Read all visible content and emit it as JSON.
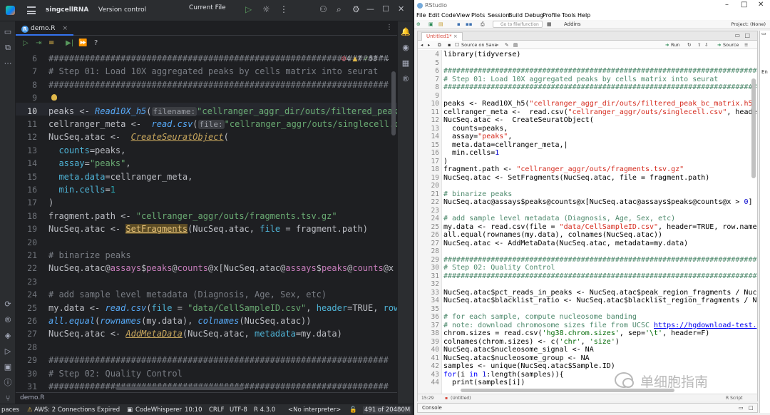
{
  "left_ide": {
    "project": "singcellRNA",
    "vcs": "Version control",
    "run_target": "Current File",
    "tab": {
      "label": "demo.R",
      "close": "×"
    },
    "inspections": {
      "errors": "4",
      "warnings": "7",
      "typos": "53"
    },
    "breadcrumb": "demo.R",
    "lines": [
      {
        "n": "6",
        "html": "<span class=\"cmt\">##################################################################</span>"
      },
      {
        "n": "7",
        "html": "<span class=\"cmt\"># Step 01: Load 10X aggregated peaks by cells matrix into seurat</span>"
      },
      {
        "n": "8",
        "html": "<span class=\"cmt\">##################################################################</span>"
      },
      {
        "n": "9",
        "html": ""
      },
      {
        "n": "10",
        "html": "peaks &lt;- <span class=\"fn\">Read10X_h5</span>(<span class=\"hint\">filename:</span><span class=\"str\">\"cellranger_aggr_dir/outs/filtered_peak_bc</span>"
      },
      {
        "n": "11",
        "html": "cellranger_meta &lt;-  <span class=\"fn\">read.csv</span>(<span class=\"hint\">file:</span><span class=\"str\">\"cellranger_aggr/outs/singlecell.csv\"</span>,"
      },
      {
        "n": "12",
        "html": "NucSeq.atac &lt;-  <span class=\"fn2\">CreateSeuratObject</span>("
      },
      {
        "n": "13",
        "html": "  <span class=\"arg\">counts</span>=peaks,"
      },
      {
        "n": "14",
        "html": "  <span class=\"arg\">assay</span>=<span class=\"str\">\"peaks\"</span>,"
      },
      {
        "n": "15",
        "html": "  <span class=\"arg\">meta.data</span>=cellranger_meta,"
      },
      {
        "n": "16",
        "html": "  <span class=\"arg\">min.cells</span>=<span class=\"num\">1</span>"
      },
      {
        "n": "17",
        "html": ")"
      },
      {
        "n": "18",
        "html": "fragment.path &lt;- <span class=\"str\">\"cellranger_aggr/outs/fragments.tsv.gz\"</span>"
      },
      {
        "n": "19",
        "html": "NucSeq.atac &lt;- <span class=\"hl-yel\">SetFragments</span>(NucSeq.atac, <span class=\"arg\">file</span> = fragment.path)"
      },
      {
        "n": "20",
        "html": ""
      },
      {
        "n": "21",
        "html": "<span class=\"cmt\"># binarize peaks</span>"
      },
      {
        "n": "22",
        "html": "NucSeq.atac@<span class=\"attr\">assays</span>$<span class=\"attr\">peaks</span>@<span class=\"attr\">counts</span>@x[NucSeq.atac@<span class=\"attr\">assays</span>$<span class=\"attr\">peaks</span>@<span class=\"attr\">counts</span>@x &gt; <span class=\"num\">0</span>]"
      },
      {
        "n": "23",
        "html": ""
      },
      {
        "n": "24",
        "html": "<span class=\"cmt\"># add sample level metadata (Diagnosis, Age, Sex, etc)</span>"
      },
      {
        "n": "25",
        "html": "my.data &lt;- <span class=\"fn\">read.csv</span>(<span class=\"arg\">file</span> = <span class=\"str\">\"data/CellSampleID.csv\"</span>, <span class=\"arg\">header</span>=TRUE, <span class=\"arg\">row.names</span>"
      },
      {
        "n": "26",
        "html": "<span class=\"fn\">all.equal</span>(<span class=\"fn\">rownames</span>(my.data), <span class=\"fn\">colnames</span>(NucSeq.atac))"
      },
      {
        "n": "27",
        "html": "NucSeq.atac &lt;- <span class=\"fn2\">AddMetaData</span>(NucSeq.atac, <span class=\"arg\">metadata</span>=my.data)"
      },
      {
        "n": "28",
        "html": ""
      },
      {
        "n": "29",
        "html": "<span class=\"cmt\">##################################################################</span>"
      },
      {
        "n": "30",
        "html": "<span class=\"cmt\"># Step 02: Quality Control</span>"
      },
      {
        "n": "31",
        "html": "<span class=\"cmt\">##################################################################</span>"
      }
    ],
    "status": {
      "spaces": "paces",
      "aws": "AWS: 2 Connections Expired",
      "codewhisperer": "CodeWhisperer",
      "position": "10:10",
      "line_sep": "CRLF",
      "encoding": "UTF-8",
      "r_version": "R 4.3.0",
      "interpreter": "<No interpreter>",
      "memory": "491 of 20480M"
    }
  },
  "rstudio": {
    "title": "RStudio",
    "menu": [
      "File",
      "Edit",
      "Code",
      "View",
      "Plots",
      "Session",
      "Build",
      "Debug",
      "Profile",
      "Tools",
      "Help"
    ],
    "goto_placeholder": "Go to file/function",
    "addins": "Addins",
    "project": "Project: (None)",
    "tab": "Untitled1*",
    "source_on_save": "Source on Save",
    "run": "Run",
    "source": "Source",
    "side_letter": "En",
    "cursor_pos": "15:29",
    "scope": "(Untitled)",
    "script_type": "R Script",
    "console": "Console",
    "lines": [
      {
        "n": "4",
        "html": "library(tidyverse)"
      },
      {
        "n": "5",
        "html": ""
      },
      {
        "n": "6",
        "html": "<span class=\"rcmt\">##############################################################################</span>"
      },
      {
        "n": "7",
        "html": "<span class=\"rcmt\"># Step 01: Load 10X aggregated peaks by cells matrix into seurat</span>"
      },
      {
        "n": "8",
        "html": "<span class=\"rcmt\">##############################################################################</span>"
      },
      {
        "n": "9",
        "html": ""
      },
      {
        "n": "10",
        "html": "peaks &lt;- Read10X_h5(<span class=\"rstr2\">\"cellranger_aggr_dir/outs/filtered_peak_bc_matrix.h5\"</span>)"
      },
      {
        "n": "11",
        "html": "cellranger_meta &lt;-  read.csv(<span class=\"rstr2\">\"cellranger_aggr/outs/singlecell.csv\"</span>, header"
      },
      {
        "n": "12",
        "html": "NucSeq.atac &lt;-  CreateSeuratObject("
      },
      {
        "n": "13",
        "html": "  counts=peaks,"
      },
      {
        "n": "14",
        "html": "  assay=<span class=\"rstr2\">\"peaks\"</span>,"
      },
      {
        "n": "15",
        "html": "  meta.data=cellranger_meta,|"
      },
      {
        "n": "16",
        "html": "  min.cells=<span class=\"rnum\">1</span>"
      },
      {
        "n": "17",
        "html": ")"
      },
      {
        "n": "18",
        "html": "fragment.path &lt;- <span class=\"rstr2\">\"cellranger_aggr/outs/fragments.tsv.gz\"</span>"
      },
      {
        "n": "19",
        "html": "NucSeq.atac &lt;- SetFragments(NucSeq.atac, file = fragment.path)"
      },
      {
        "n": "20",
        "html": ""
      },
      {
        "n": "21",
        "html": "<span class=\"rcmt\"># binarize peaks</span>"
      },
      {
        "n": "22",
        "html": "NucSeq.atac@assays$peaks@counts@x[NucSeq.atac@assays$peaks@counts@x &gt; <span class=\"rnum\">0</span>]"
      },
      {
        "n": "23",
        "html": ""
      },
      {
        "n": "24",
        "html": "<span class=\"rcmt\"># add sample level metadata (Diagnosis, Age, Sex, etc)</span>"
      },
      {
        "n": "25",
        "html": "my.data &lt;- read.csv(file = <span class=\"rstr2\">\"data/CellSampleID.csv\"</span>, header=TRUE, row.name"
      },
      {
        "n": "26",
        "html": "all.equal(rownames(my.data), colnames(NucSeq.atac))"
      },
      {
        "n": "27",
        "html": "NucSeq.atac &lt;- AddMetaData(NucSeq.atac, metadata=my.data)"
      },
      {
        "n": "28",
        "html": ""
      },
      {
        "n": "29",
        "html": "<span class=\"rcmt\">##############################################################################</span>"
      },
      {
        "n": "30",
        "html": "<span class=\"rcmt\"># Step 02: Quality Control</span>"
      },
      {
        "n": "31",
        "html": "<span class=\"rcmt\">##############################################################################</span>"
      },
      {
        "n": "32",
        "html": ""
      },
      {
        "n": "33",
        "html": "NucSeq.atac$pct_reads_in_peaks &lt;- NucSeq.atac$peak_region_fragments / Nuc"
      },
      {
        "n": "34",
        "html": "NucSeq.atac$blacklist_ratio &lt;- NucSeq.atac$blacklist_region_fragments / N"
      },
      {
        "n": "35",
        "html": ""
      },
      {
        "n": "36",
        "html": "<span class=\"rcmt\"># for each sample, compute nucleosome banding</span>"
      },
      {
        "n": "37",
        "html": "<span class=\"rcmt\"># note: download chromosome sizes file from UCSC <span class=\"rlink\">https://hgdownload-test.</span></span>"
      },
      {
        "n": "38",
        "html": "chrom.sizes = read.csv(<span class=\"rstr\">'hg38.chrom.sizes'</span>, sep=<span class=\"rstr\">'\\t'</span>, header=F)"
      },
      {
        "n": "39",
        "html": "colnames(chrom.sizes) &lt;- c(<span class=\"rstr\">'chr'</span>, <span class=\"rstr\">'size'</span>)"
      },
      {
        "n": "40",
        "html": "NucSeq.atac$nucleosome_signal &lt;- NA"
      },
      {
        "n": "41",
        "html": "NucSeq.atac$nucleosome_group &lt;- NA"
      },
      {
        "n": "42",
        "html": "samples &lt;- unique(NucSeq.atac$Sample.ID)"
      },
      {
        "n": "43",
        "html": "<span class=\"rkw\">for</span>(i <span class=\"rkw\">in</span> <span class=\"rnum\">1</span>:length(samples)){"
      },
      {
        "n": "44",
        "html": "  print(samples[i])"
      }
    ]
  },
  "watermark": "单细胞指南",
  "colors": {
    "ide_bg": "#1e1f22",
    "accent": "#3574f0",
    "rstudio_bg": "#f0f0f0"
  }
}
